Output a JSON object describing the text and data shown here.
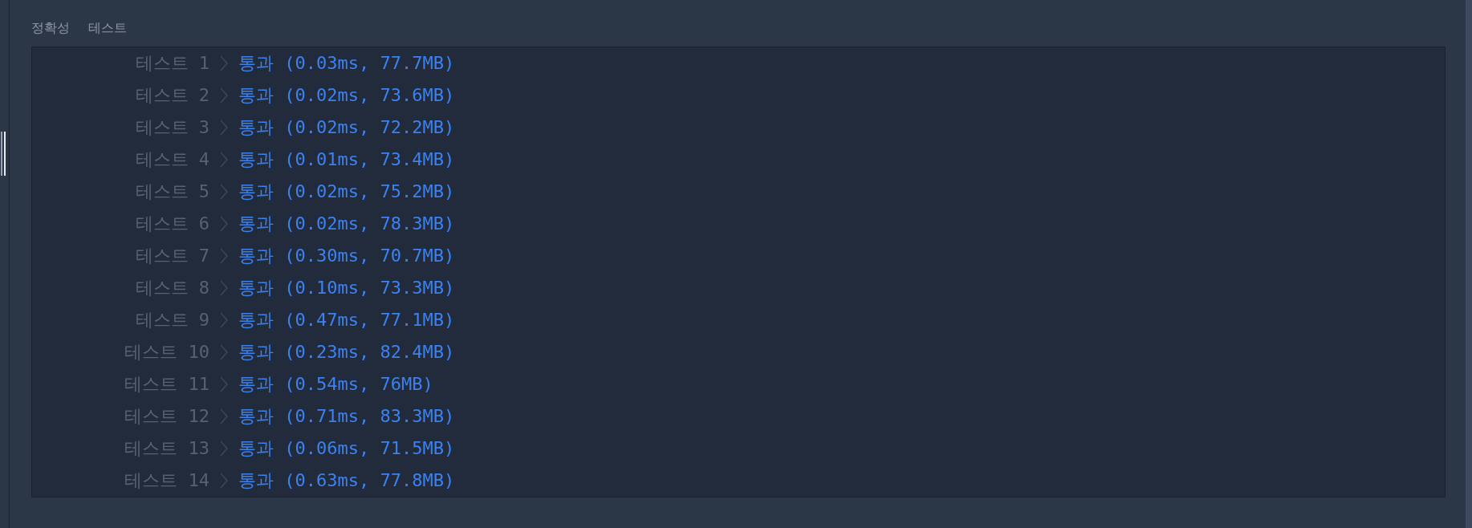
{
  "section_title": "정확성 테스트",
  "results": [
    {
      "label": "테스트 1",
      "result": "통과 (0.03ms, 77.7MB)"
    },
    {
      "label": "테스트 2",
      "result": "통과 (0.02ms, 73.6MB)"
    },
    {
      "label": "테스트 3",
      "result": "통과 (0.02ms, 72.2MB)"
    },
    {
      "label": "테스트 4",
      "result": "통과 (0.01ms, 73.4MB)"
    },
    {
      "label": "테스트 5",
      "result": "통과 (0.02ms, 75.2MB)"
    },
    {
      "label": "테스트 6",
      "result": "통과 (0.02ms, 78.3MB)"
    },
    {
      "label": "테스트 7",
      "result": "통과 (0.30ms, 70.7MB)"
    },
    {
      "label": "테스트 8",
      "result": "통과 (0.10ms, 73.3MB)"
    },
    {
      "label": "테스트 9",
      "result": "통과 (0.47ms, 77.1MB)"
    },
    {
      "label": "테스트 10",
      "result": "통과 (0.23ms, 82.4MB)"
    },
    {
      "label": "테스트 11",
      "result": "통과 (0.54ms, 76MB)"
    },
    {
      "label": "테스트 12",
      "result": "통과 (0.71ms, 83.3MB)"
    },
    {
      "label": "테스트 13",
      "result": "통과 (0.06ms, 71.5MB)"
    },
    {
      "label": "테스트 14",
      "result": "통과 (0.63ms, 77.8MB)"
    }
  ]
}
